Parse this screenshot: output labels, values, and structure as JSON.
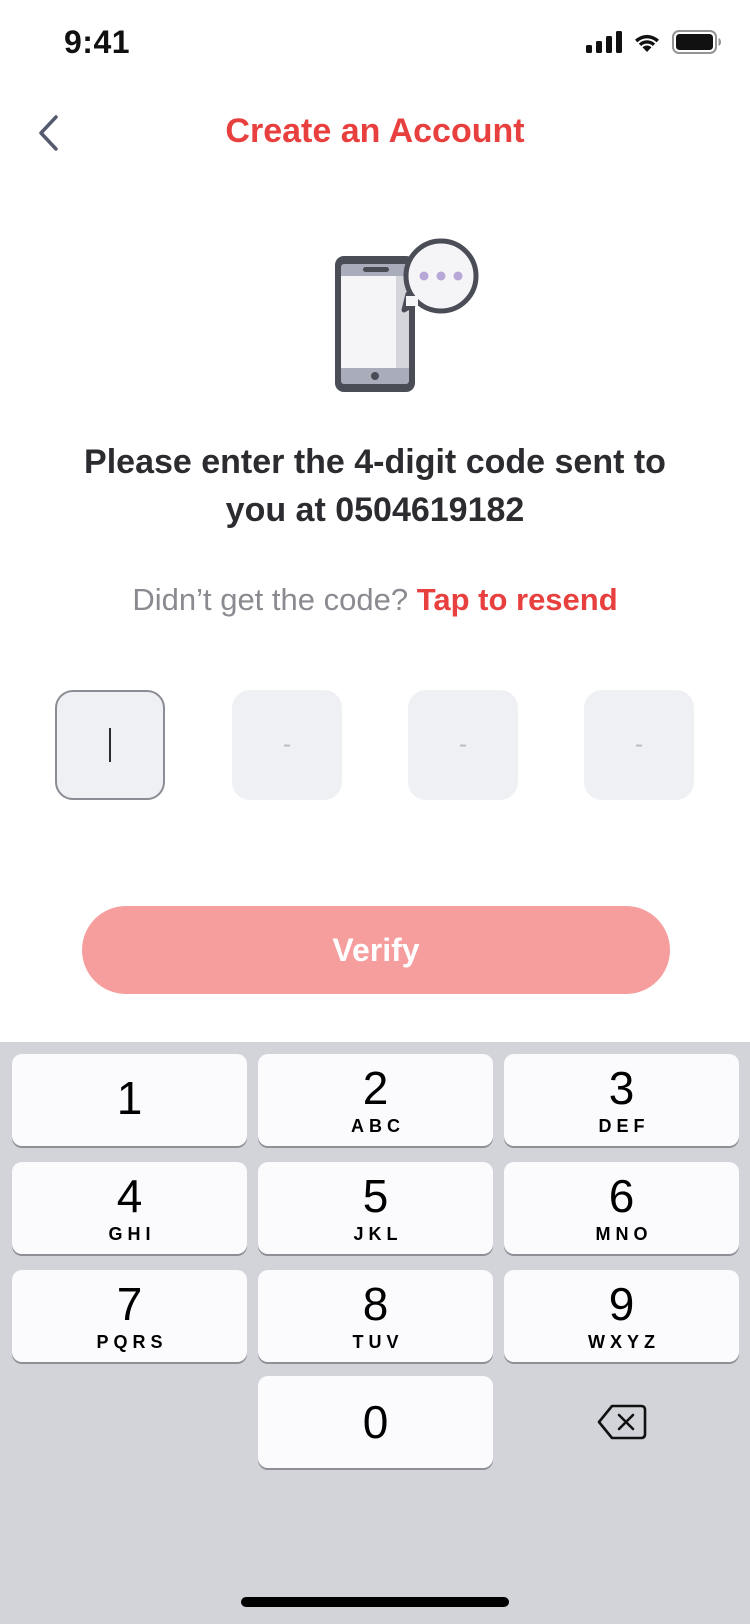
{
  "status_bar": {
    "time": "9:41"
  },
  "nav": {
    "title": "Create an Account"
  },
  "verification": {
    "heading_line1": "Please enter the 4-digit code sent to",
    "heading_line2": "you at 0504619182",
    "resend_prompt": "Didn’t get the code?",
    "resend_link": "Tap to resend",
    "code_slots": [
      "",
      "-",
      "-",
      "-"
    ],
    "verify_label": "Verify"
  },
  "keypad": {
    "keys": [
      {
        "number": "1",
        "letters": ""
      },
      {
        "number": "2",
        "letters": "ABC"
      },
      {
        "number": "3",
        "letters": "DEF"
      },
      {
        "number": "4",
        "letters": "GHI"
      },
      {
        "number": "5",
        "letters": "JKL"
      },
      {
        "number": "6",
        "letters": "MNO"
      },
      {
        "number": "7",
        "letters": "PQRS"
      },
      {
        "number": "8",
        "letters": "TUV"
      },
      {
        "number": "9",
        "letters": "WXYZ"
      },
      {
        "number": "0",
        "letters": ""
      }
    ]
  },
  "colors": {
    "accent": "#e8403f",
    "verify_button": "#f59e9d",
    "nav_icon": "#555a6e",
    "keypad_bg": "#d2d4da"
  },
  "icons": {
    "back": "chevron-left-icon",
    "illustration": "phone-message-icon",
    "delete": "backspace-icon"
  }
}
